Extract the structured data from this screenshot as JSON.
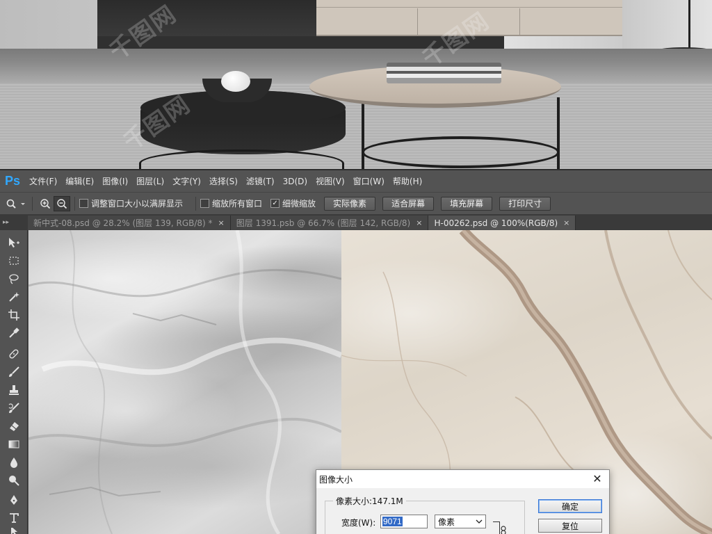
{
  "photo": {
    "watermark": "千图网"
  },
  "app": {
    "logo": "Ps"
  },
  "menu": {
    "items": [
      {
        "label": "文件(F)"
      },
      {
        "label": "编辑(E)"
      },
      {
        "label": "图像(I)"
      },
      {
        "label": "图层(L)"
      },
      {
        "label": "文字(Y)"
      },
      {
        "label": "选择(S)"
      },
      {
        "label": "滤镜(T)"
      },
      {
        "label": "3D(D)"
      },
      {
        "label": "视图(V)"
      },
      {
        "label": "窗口(W)"
      },
      {
        "label": "帮助(H)"
      }
    ]
  },
  "options": {
    "resize_windows": {
      "label": "调整窗口大小以满屏显示",
      "checked": false
    },
    "zoom_all": {
      "label": "缩放所有窗口",
      "checked": false
    },
    "scrubby_zoom": {
      "label": "细微缩放",
      "checked": true
    },
    "buttons": {
      "actual_pixels": "实际像素",
      "fit_screen": "适合屏幕",
      "fill_screen": "填充屏幕",
      "print_size": "打印尺寸"
    }
  },
  "tabs": [
    {
      "label": "新中式-08.psd @ 28.2% (图层 139, RGB/8) *",
      "active": false
    },
    {
      "label": "图层 1391.psb @ 66.7% (图层 142, RGB/8)",
      "active": false
    },
    {
      "label": "H-00262.psd @ 100%(RGB/8)",
      "active": true
    }
  ],
  "tab_close": "×",
  "dialog": {
    "title": "图像大小",
    "close": "✕",
    "pixel_dimensions": "像素大小:147.1M",
    "width_label": "宽度(W):",
    "width_value": "9071",
    "unit": "像素",
    "ok": "确定",
    "reset": "复位"
  },
  "colors": {
    "ps_blue": "#31a8ff",
    "ui_bg": "#535353",
    "tab_bar": "#3a3a3a",
    "selection": "#3169c6"
  }
}
